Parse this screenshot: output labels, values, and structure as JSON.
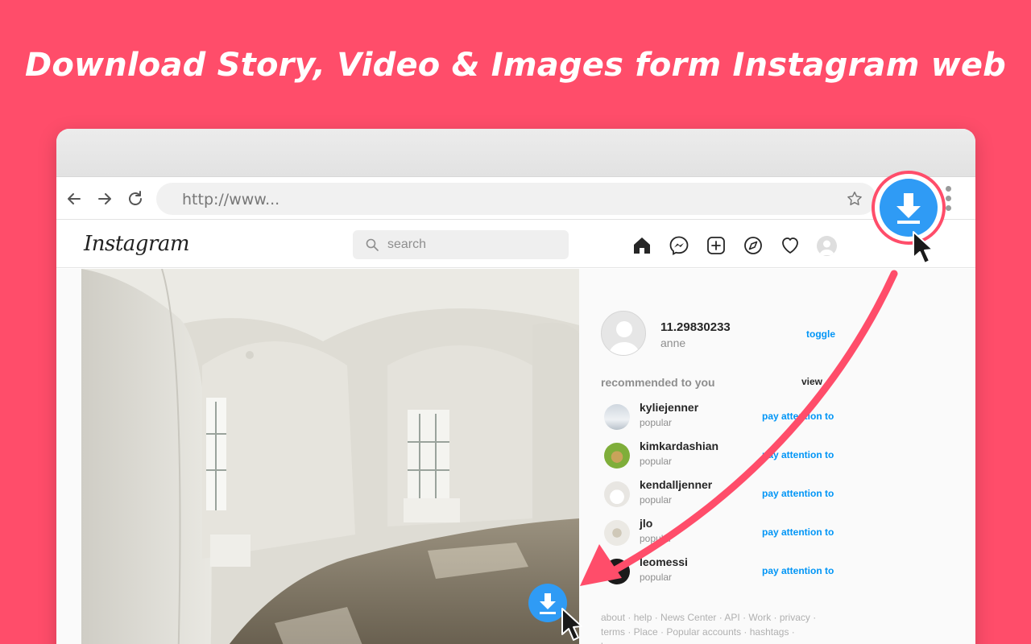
{
  "headline": "Download Story, Video & Images form Instagram web",
  "browser": {
    "url": "http://www...",
    "back_icon": "arrow-left-icon",
    "forward_icon": "arrow-right-icon",
    "reload_icon": "reload-icon",
    "bookmark_icon": "star-icon",
    "menu_icon": "kebab-menu-icon"
  },
  "instagram": {
    "logo": "Instagram",
    "search_placeholder": "search",
    "nav_icons": [
      "home-icon",
      "messenger-icon",
      "new-post-icon",
      "explore-icon",
      "heart-icon",
      "profile-avatar"
    ]
  },
  "profile": {
    "name": "11.29830233",
    "subtitle": "anne",
    "toggle": "toggle"
  },
  "recommended": {
    "title": "recommended to you",
    "view": "view",
    "items": [
      {
        "name": "kyliejenner",
        "sub": "popular",
        "action": "pay attention to"
      },
      {
        "name": "kimkardashian",
        "sub": "popular",
        "action": "pay attention to"
      },
      {
        "name": "kendalljenner",
        "sub": "popular",
        "action": "pay attention to"
      },
      {
        "name": "jlo",
        "sub": "popular",
        "action": "pay attention to"
      },
      {
        "name": "leomessi",
        "sub": "popular",
        "action": "pay attention to"
      }
    ]
  },
  "footer": {
    "line1": "about · help · News Center · API · Work · privacy ·",
    "line2": "terms · Place · Popular accounts · hashtags ·",
    "line3": "language"
  },
  "colors": {
    "background": "#ff4d6a",
    "download_blue": "#2f9bf5",
    "link_blue": "#0095f6"
  }
}
